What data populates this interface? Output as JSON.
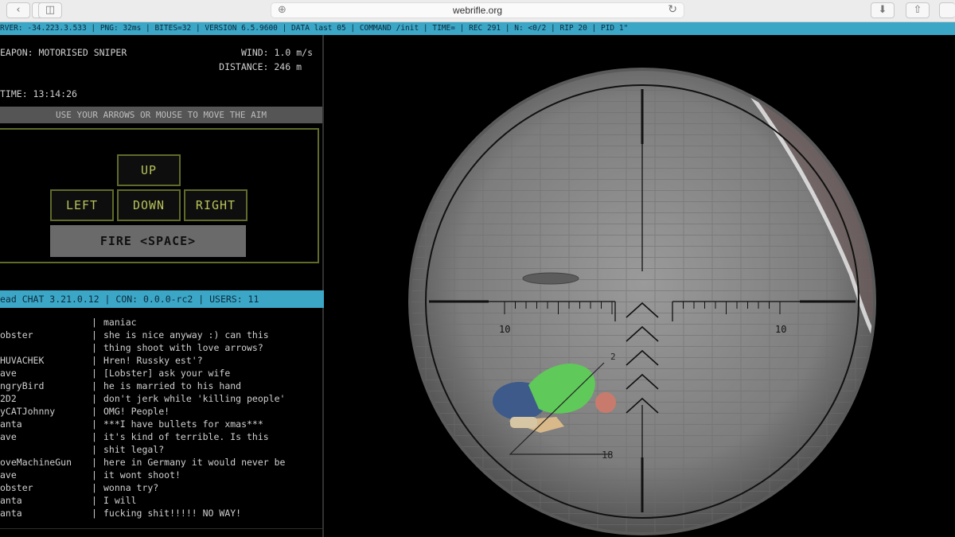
{
  "browser": {
    "url": "webrifle.org"
  },
  "ticker": {
    "text": "RVER: -34.223.3.533  |  PNG: 32ms  |  BITES=32  |  VERSION 6.5.9600  |  DATA last 05  |  COMMAND /init  |  TIME=  |  REC 291  |  N: <0/2  |  RIP 20  |  PID 1\""
  },
  "panel": {
    "weapon": "EAPON: MOTORISED SNIPER",
    "wind": "WIND: 1.0 m/s",
    "distance": "DISTANCE: 246 m",
    "time": "TIME: 13:14:26",
    "instructions": "USE YOUR ARROWS OR MOUSE TO MOVE THE AIM"
  },
  "controls": {
    "up": "UP",
    "left": "LEFT",
    "down": "DOWN",
    "right": "RIGHT",
    "fire": "FIRE <SPACE>"
  },
  "chat": {
    "header": "ead CHAT 3.21.0.12 | CON: 0.0.0-rc2 | USERS: 11",
    "separator": "|",
    "messages": [
      {
        "user": "",
        "text": "maniac"
      },
      {
        "user": "obster",
        "text": "she is nice anyway :) can this"
      },
      {
        "user": "",
        "text": "thing shoot with love arrows?"
      },
      {
        "user": "HUVACHEK",
        "text": "Hren! Russky est'?"
      },
      {
        "user": "ave",
        "text": "[Lobster] ask your wife"
      },
      {
        "user": "ngryBird",
        "text": "he is married to his hand"
      },
      {
        "user": "2D2",
        "text": "don't jerk while 'killing people'"
      },
      {
        "user": "yCATJohnny",
        "text": "OMG! People!"
      },
      {
        "user": "anta",
        "text": "***I have bullets for xmas***"
      },
      {
        "user": "ave",
        "text": "it's kind of terrible. Is this"
      },
      {
        "user": "",
        "text": "shit legal?"
      },
      {
        "user": "oveMachineGun",
        "text": "here in Germany it would never be"
      },
      {
        "user": "ave",
        "text": "it wont shoot!"
      },
      {
        "user": "obster",
        "text": "wonna try?"
      },
      {
        "user": "anta",
        "text": "I will"
      },
      {
        "user": "anta",
        "text": "fucking shit!!!!! NO WAY!"
      }
    ]
  },
  "scope": {
    "left_mark": "10",
    "right_mark": "10",
    "range_label": "18",
    "angle_label": "2"
  }
}
